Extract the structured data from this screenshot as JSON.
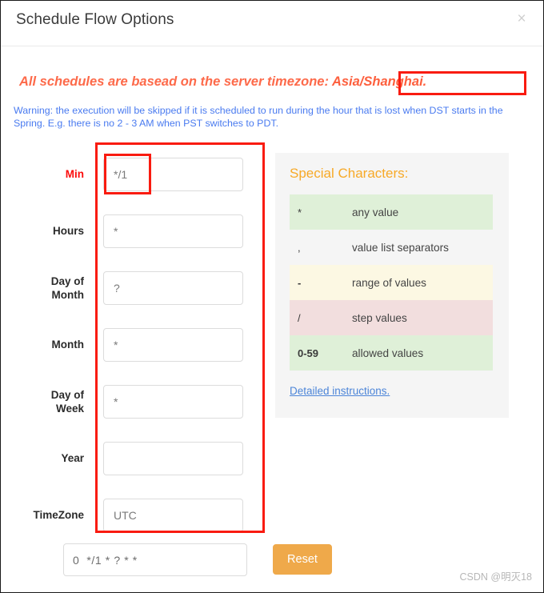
{
  "dialog": {
    "title": "Schedule Flow Options",
    "close_icon": "close-icon",
    "close_label": "×"
  },
  "notices": {
    "timezone_prefix": "All schedules are basead on the server timezone: ",
    "timezone_value": "Asia/Shanghai.",
    "dst_warning": "Warning: the execution will be skipped if it is scheduled to run during the hour that is lost when DST starts in the Spring. E.g. there is no 2 - 3 AM when PST switches to PDT."
  },
  "form": {
    "fields": [
      {
        "label": "Min",
        "value": "*/1",
        "placeholder": "",
        "accent": true
      },
      {
        "label": "Hours",
        "value": "*",
        "placeholder": "",
        "accent": false
      },
      {
        "label": "Day of Month",
        "label_line1": "Day of",
        "label_line2": "Month",
        "value": "?",
        "placeholder": "",
        "accent": false
      },
      {
        "label": "Month",
        "value": "*",
        "placeholder": "",
        "accent": false
      },
      {
        "label": "Day of Week",
        "label_line1": "Day of",
        "label_line2": "Week",
        "value": "*",
        "placeholder": "",
        "accent": false
      },
      {
        "label": "Year",
        "value": "",
        "placeholder": "",
        "accent": false
      },
      {
        "label": "TimeZone",
        "value": "UTC",
        "placeholder": "",
        "accent": false
      }
    ],
    "cron_expression": "0  */1 * ? * *",
    "reset_label": "Reset"
  },
  "special_characters": {
    "title": "Special Characters:",
    "rows": [
      {
        "symbol": "*",
        "description": "any value",
        "tone": "green"
      },
      {
        "symbol": ",",
        "description": "value list separators",
        "tone": "plain"
      },
      {
        "symbol": "-",
        "description": "range of values",
        "tone": "cream"
      },
      {
        "symbol": "/",
        "description": "step values",
        "tone": "pink"
      },
      {
        "symbol": "0-59",
        "description": "allowed values",
        "tone": "green"
      }
    ],
    "details_link": "Detailed instructions."
  },
  "watermark": "CSDN @明灭18",
  "colors": {
    "notice_orange": "#fd6a4a",
    "warning_blue": "#4a7bf0",
    "accent_red": "#fb0d0d",
    "annotation_red": "#f91b10",
    "panel_title_orange": "#f7a927",
    "reset_orange": "#efa94a",
    "link_blue": "#4c85d8",
    "row_green": "#dff0d8",
    "row_cream": "#fcf8e3",
    "row_pink": "#f2dede"
  }
}
